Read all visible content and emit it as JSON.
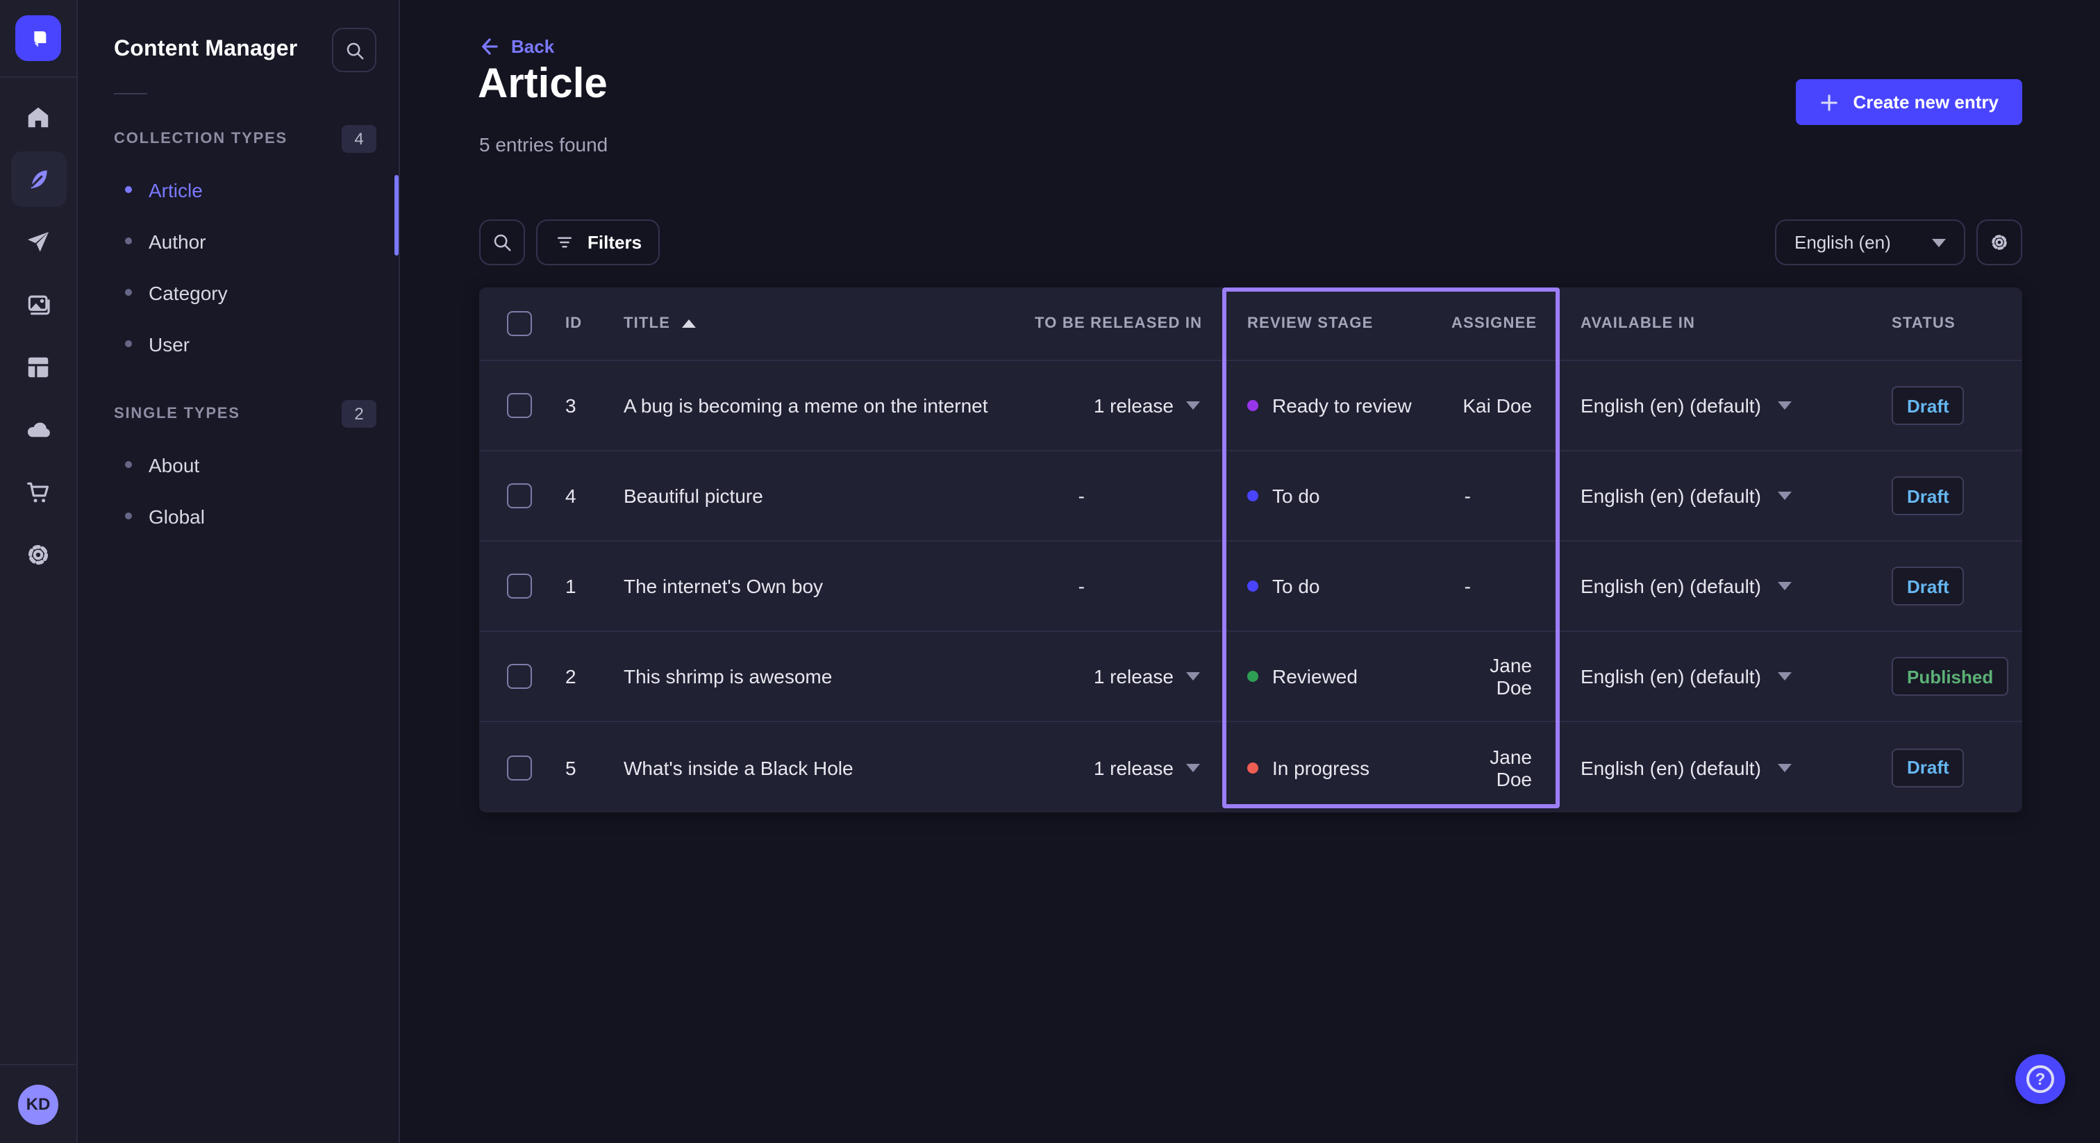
{
  "nav_rail": {
    "icons": [
      "strapi-logo",
      "home-icon",
      "content-manager-feather-icon",
      "releases-paper-plane-icon",
      "media-library-images-icon",
      "content-type-builder-layout-icon",
      "deploy-cloud-icon",
      "marketplace-cart-icon",
      "settings-gear-icon"
    ],
    "active_icon": "content-manager-feather-icon",
    "avatar_initials": "KD"
  },
  "subnav": {
    "title": "Content Manager",
    "search_icon": "search-icon",
    "sections": [
      {
        "label": "COLLECTION TYPES",
        "badge": "4",
        "items": [
          {
            "label": "Article",
            "active": true
          },
          {
            "label": "Author",
            "active": false
          },
          {
            "label": "Category",
            "active": false
          },
          {
            "label": "User",
            "active": false
          }
        ]
      },
      {
        "label": "SINGLE TYPES",
        "badge": "2",
        "items": [
          {
            "label": "About",
            "active": false
          },
          {
            "label": "Global",
            "active": false
          }
        ]
      }
    ]
  },
  "header": {
    "back_label": "Back",
    "title": "Article",
    "subtitle": "5 entries found",
    "create_button_label": "Create new entry"
  },
  "toolbar": {
    "filters_label": "Filters",
    "locale_value": "English (en)"
  },
  "table": {
    "headers": {
      "id": "ID",
      "title": "TITLE",
      "title_sort": "ascending",
      "to_be_released_in": "TO BE RELEASED IN",
      "review_stage": "REVIEW STAGE",
      "assignee": "ASSIGNEE",
      "available_in": "AVAILABLE IN",
      "status": "STATUS"
    },
    "rows": [
      {
        "id": "3",
        "title": "A bug is becoming a meme on the internet",
        "to_be_released_in": "1 release",
        "release_menu": true,
        "review_stage": "Ready to review",
        "stage_color": "#9736e8",
        "assignee": "Kai Doe",
        "available_in": "English (en) (default)",
        "status": "Draft"
      },
      {
        "id": "4",
        "title": "Beautiful picture",
        "to_be_released_in": "-",
        "release_menu": false,
        "review_stage": "To do",
        "stage_color": "#4945ff",
        "assignee": "-",
        "available_in": "English (en) (default)",
        "status": "Draft"
      },
      {
        "id": "1",
        "title": "The internet's Own boy",
        "to_be_released_in": "-",
        "release_menu": false,
        "review_stage": "To do",
        "stage_color": "#4945ff",
        "assignee": "-",
        "available_in": "English (en) (default)",
        "status": "Draft"
      },
      {
        "id": "2",
        "title": "This shrimp is awesome",
        "to_be_released_in": "1 release",
        "release_menu": true,
        "review_stage": "Reviewed",
        "stage_color": "#2f9e55",
        "assignee": "Jane Doe",
        "available_in": "English (en) (default)",
        "status": "Published"
      },
      {
        "id": "5",
        "title": "What's inside a Black Hole",
        "to_be_released_in": "1 release",
        "release_menu": true,
        "review_stage": "In progress",
        "stage_color": "#ee5e52",
        "assignee": "Jane Doe",
        "available_in": "English (en) (default)",
        "status": "Draft"
      }
    ]
  },
  "colors": {
    "primary": "#4945ff",
    "link": "#7b79ff",
    "highlight_border": "#9c7ef8",
    "status_text": {
      "Draft": "#66b7f1",
      "Published": "#5cb176"
    }
  },
  "help": {
    "icon_glyph": "?"
  }
}
